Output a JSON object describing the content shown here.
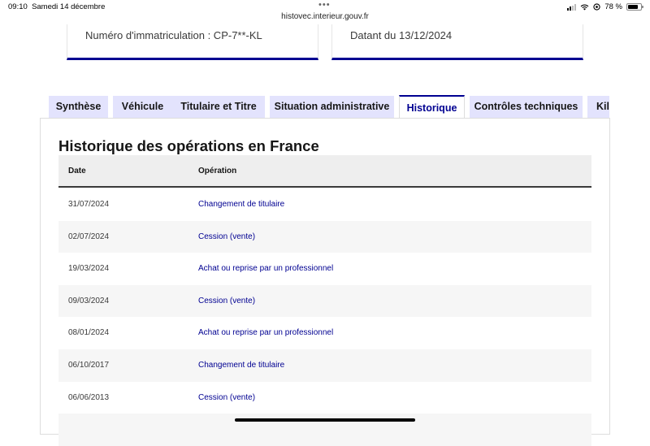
{
  "statusbar": {
    "time": "09:10",
    "date": "Samedi 14 décembre",
    "dots": "•••",
    "url": "histovec.interieur.gouv.fr",
    "battery": "78 %",
    "battery_level": 0.78
  },
  "cards": {
    "registration": "Numéro d'immatriculation : CP-7**-KL",
    "dated": "Datant du 13/12/2024"
  },
  "tabs": [
    {
      "label": "Synthèse",
      "active": false
    },
    {
      "label": "Véhicule",
      "active": false
    },
    {
      "label": "Titulaire et Titre",
      "active": false
    },
    {
      "label": "Situation administrative",
      "active": false
    },
    {
      "label": "Historique",
      "active": true
    },
    {
      "label": "Contrôles techniques",
      "active": false
    },
    {
      "label": "Kilométrage",
      "active": false
    }
  ],
  "section": {
    "title": "Historique des opérations en France"
  },
  "table": {
    "headers": {
      "date": "Date",
      "operation": "Opération"
    },
    "rows": [
      {
        "date": "31/07/2024",
        "operation": "Changement de titulaire"
      },
      {
        "date": "02/07/2024",
        "operation": "Cession (vente)"
      },
      {
        "date": "19/03/2024",
        "operation": "Achat ou reprise par un professionnel"
      },
      {
        "date": "09/03/2024",
        "operation": "Cession (vente)"
      },
      {
        "date": "08/01/2024",
        "operation": "Achat ou reprise par un professionnel"
      },
      {
        "date": "06/10/2017",
        "operation": "Changement de titulaire"
      },
      {
        "date": "06/06/2013",
        "operation": "Cession (vente)"
      }
    ]
  },
  "colors": {
    "accent": "#000091",
    "tab_bg": "#e3e3fd",
    "row_alt": "#f6f6f6"
  }
}
